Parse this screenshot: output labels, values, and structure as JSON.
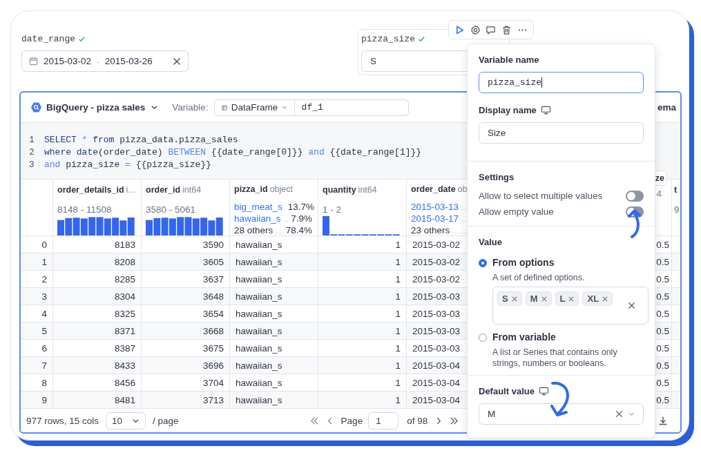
{
  "variables": [
    {
      "kind": "date_range",
      "name": "date_range",
      "valid": true,
      "start": "2015-03-02",
      "separator": "-",
      "end": "2015-03-26"
    },
    {
      "kind": "select",
      "name": "pizza_size",
      "valid": true,
      "value": "S"
    }
  ],
  "sql_cell": {
    "connection": "BigQuery - pizza sales",
    "variable_label": "Variable:",
    "variable_type": "DataFrame",
    "variable_name": "df_1",
    "schema_button": "ema",
    "floating_button": "ze",
    "code": [
      {
        "number": "1",
        "tokens": [
          {
            "kind": "keyword",
            "text": "SELECT"
          },
          {
            "kind": "operator",
            "text": " * "
          },
          {
            "kind": "keyword",
            "text": "from"
          },
          {
            "kind": "plain",
            "text": " pizza_data.pizza_sales"
          }
        ]
      },
      {
        "number": "2",
        "tokens": [
          {
            "kind": "keyword",
            "text": "where date"
          },
          {
            "kind": "plain",
            "text": "(order_date) "
          },
          {
            "kind": "operator",
            "text": "BETWEEN"
          },
          {
            "kind": "plain",
            "text": " {{date_range[0]}} "
          },
          {
            "kind": "operator",
            "text": "and"
          },
          {
            "kind": "plain",
            "text": " {{date_range[1]}}"
          }
        ]
      },
      {
        "number": "3",
        "tokens": [
          {
            "kind": "operator",
            "text": "and"
          },
          {
            "kind": "plain",
            "text": " pizza_size "
          },
          {
            "kind": "operator",
            "text": "="
          },
          {
            "kind": "plain",
            "text": " {{pizza_size}}"
          }
        ]
      }
    ]
  },
  "table": {
    "columns": [
      {
        "kind": "range_histogram",
        "name": "order_details_id",
        "dtype": "i...",
        "range": "8148 - 11508"
      },
      {
        "kind": "range_histogram",
        "name": "order_id",
        "dtype": "int64",
        "range": "3580 - 5061"
      },
      {
        "kind": "top_values",
        "name": "pizza_id",
        "dtype": "object",
        "top": [
          {
            "label": "big_meat_s",
            "share": "13.7%",
            "link": true
          },
          {
            "label": "hawaiian_s",
            "share": "7.9%",
            "link": true
          },
          {
            "label": "28 others",
            "share": "78.4%",
            "link": false
          }
        ]
      },
      {
        "kind": "range_histogram_skewed",
        "name": "quantity",
        "dtype": "int64",
        "range": "1 - 2"
      },
      {
        "kind": "top_values",
        "name": "order_date",
        "dtype": "ob",
        "top": [
          {
            "label": "2015-03-13",
            "link": true
          },
          {
            "label": "2015-03-17",
            "link": true
          },
          {
            "label": "23 others",
            "link": false
          }
        ]
      },
      {
        "kind": "fragment",
        "dtype": "4"
      },
      {
        "kind": "cut",
        "name": "t",
        "range": "9"
      }
    ],
    "rows": [
      {
        "index": "0",
        "cells": [
          "8183",
          "3590",
          "hawaiian_s",
          "1",
          "2015-03-02",
          "0.5"
        ]
      },
      {
        "index": "1",
        "cells": [
          "8208",
          "3605",
          "hawaiian_s",
          "1",
          "2015-03-02",
          "0.5"
        ]
      },
      {
        "index": "2",
        "cells": [
          "8285",
          "3637",
          "hawaiian_s",
          "1",
          "2015-03-02",
          "0.5"
        ]
      },
      {
        "index": "3",
        "cells": [
          "8304",
          "3648",
          "hawaiian_s",
          "1",
          "2015-03-03",
          "0.5"
        ]
      },
      {
        "index": "4",
        "cells": [
          "8325",
          "3654",
          "hawaiian_s",
          "1",
          "2015-03-03",
          "0.5"
        ]
      },
      {
        "index": "5",
        "cells": [
          "8371",
          "3668",
          "hawaiian_s",
          "1",
          "2015-03-03",
          "0.5"
        ]
      },
      {
        "index": "6",
        "cells": [
          "8387",
          "3675",
          "hawaiian_s",
          "1",
          "2015-03-03",
          "0.5"
        ]
      },
      {
        "index": "7",
        "cells": [
          "8433",
          "3696",
          "hawaiian_s",
          "1",
          "2015-03-04",
          "0.5"
        ]
      },
      {
        "index": "8",
        "cells": [
          "8456",
          "3704",
          "hawaiian_s",
          "1",
          "2015-03-04",
          "0.5"
        ]
      },
      {
        "index": "9",
        "cells": [
          "8481",
          "3713",
          "hawaiian_s",
          "1",
          "2015-03-04",
          "0.5"
        ]
      }
    ],
    "footer": {
      "summary": "977 rows, 15 cols",
      "page_size": "10",
      "per_page": "/ page",
      "page_label": "Page",
      "page": "1",
      "page_total": "of 98"
    }
  },
  "variable_popover": {
    "variable_name_label": "Variable name",
    "variable_name": "pizza_size",
    "display_name_label": "Display name",
    "display_name": "Size",
    "settings_title": "Settings",
    "settings": [
      {
        "label": "Allow to select multiple values",
        "on": false
      },
      {
        "label": "Allow empty value",
        "on": false
      }
    ],
    "value_title": "Value",
    "sources": [
      {
        "label": "From options",
        "description": "A set of defined options.",
        "selected": true,
        "options": [
          "S",
          "M",
          "L",
          "XL"
        ]
      },
      {
        "label": "From variable",
        "description": "A list or Series that contains only strings, numbers or booleans.",
        "selected": false
      }
    ],
    "default_value_label": "Default value",
    "default_value": "M"
  }
}
